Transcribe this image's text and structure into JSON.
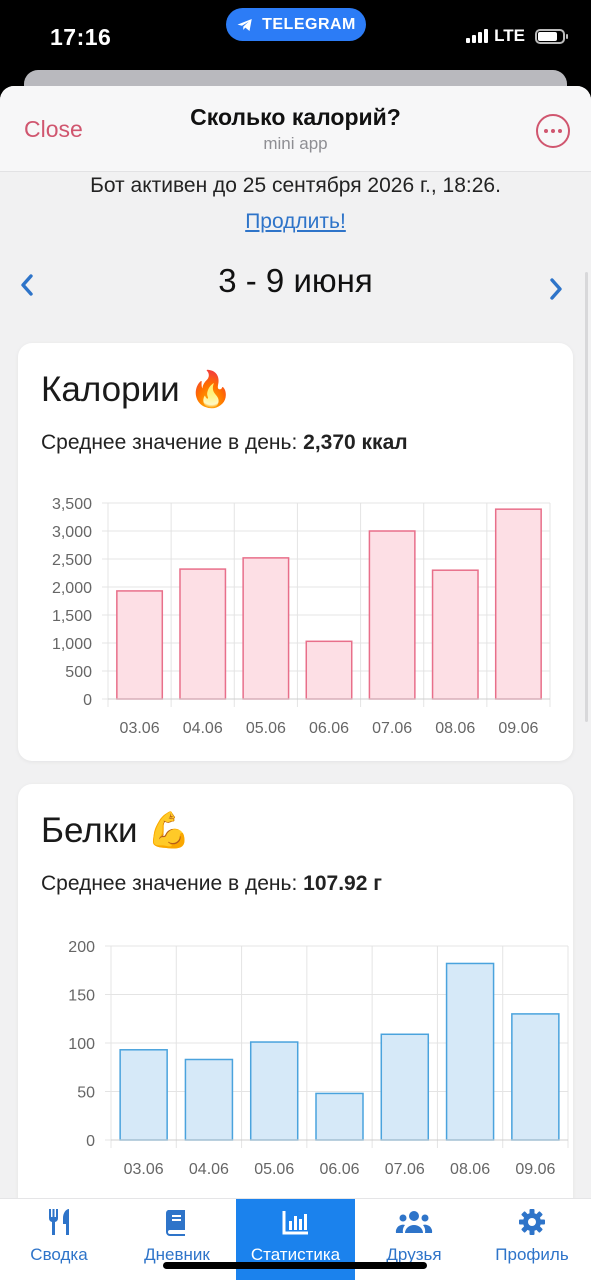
{
  "status": {
    "time": "17:16",
    "network": "LTE",
    "badge": "TELEGRAM"
  },
  "header": {
    "close_label": "Close",
    "title": "Сколько калорий?",
    "subtitle": "mini app"
  },
  "subscription": {
    "text": "Бот активен до 25 сентября 2026 г., 18:26.",
    "renew_label": "Продлить!"
  },
  "week": {
    "label": "3 - 9 июня"
  },
  "calories": {
    "title": "Калории 🔥",
    "avg_label": "Среднее значение в день:",
    "avg_value": "2,370 ккал"
  },
  "protein": {
    "title": "Белки 💪",
    "avg_label": "Среднее значение в день:",
    "avg_value": "107.92 г"
  },
  "chart_data": [
    {
      "type": "bar",
      "categories": [
        "03.06",
        "04.06",
        "05.06",
        "06.06",
        "07.06",
        "08.06",
        "09.06"
      ],
      "values": [
        1930,
        2320,
        2520,
        1030,
        3000,
        2300,
        3390
      ],
      "ylim": [
        0,
        3500
      ],
      "yticks": [
        "0",
        "500",
        "1,000",
        "1,500",
        "2,000",
        "2,500",
        "3,000",
        "3,500"
      ],
      "fill": "#fddfe5",
      "stroke": "#e86f8a",
      "grid": true
    },
    {
      "type": "bar",
      "categories": [
        "03.06",
        "04.06",
        "05.06",
        "06.06",
        "07.06",
        "08.06",
        "09.06"
      ],
      "values": [
        93,
        83,
        101,
        48,
        109,
        182,
        130
      ],
      "ylim": [
        0,
        200
      ],
      "yticks": [
        "0",
        "50",
        "100",
        "150",
        "200"
      ],
      "fill": "#d6e9f8",
      "stroke": "#4aa3dd",
      "grid": true
    }
  ],
  "tabs": [
    {
      "label": "Сводка",
      "icon": "utensils-icon"
    },
    {
      "label": "Дневник",
      "icon": "book-icon"
    },
    {
      "label": "Статистика",
      "icon": "chart-bar-icon",
      "active": true
    },
    {
      "label": "Друзья",
      "icon": "users-icon"
    },
    {
      "label": "Профиль",
      "icon": "gear-icon"
    }
  ],
  "colors": {
    "accent": "#2e74c9",
    "close": "#d0566f",
    "active_tab": "#1b82ed"
  }
}
